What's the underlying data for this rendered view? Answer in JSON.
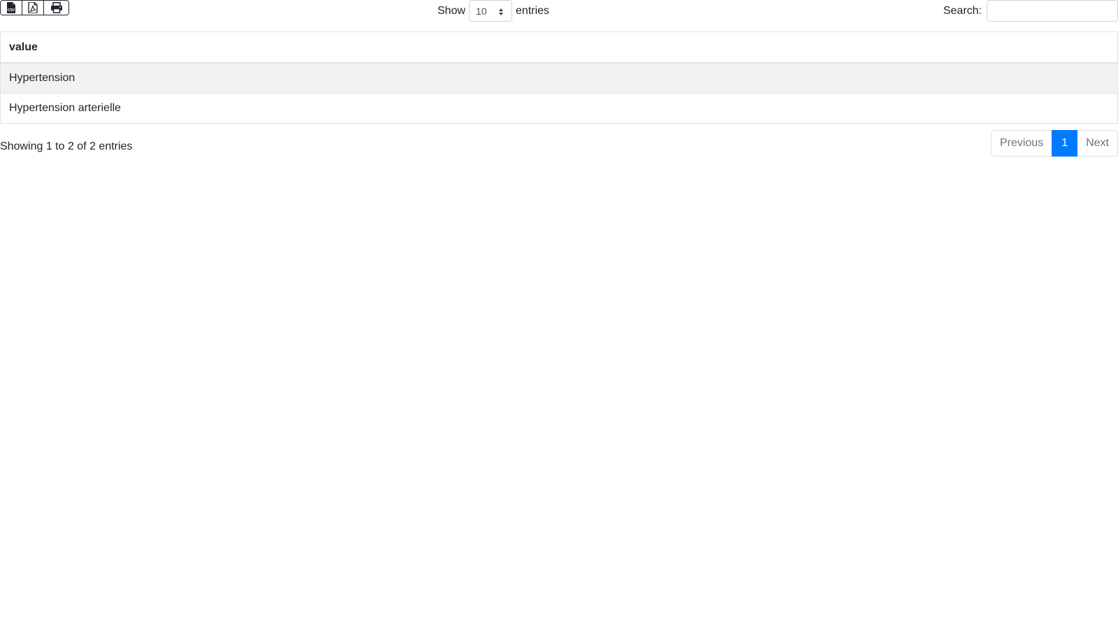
{
  "toolbar": {
    "export_buttons": [
      {
        "icon": "file-csv-icon"
      },
      {
        "icon": "file-pdf-icon"
      },
      {
        "icon": "print-icon"
      }
    ]
  },
  "length": {
    "label_before": "Show",
    "selected": "10",
    "label_after": "entries"
  },
  "search": {
    "label": "Search:",
    "value": "",
    "placeholder": ""
  },
  "table": {
    "columns": [
      "value"
    ],
    "rows": [
      [
        "Hypertension"
      ],
      [
        "Hypertension arterielle"
      ]
    ]
  },
  "footer": {
    "info": "Showing 1 to 2 of 2 entries",
    "prev_label": "Previous",
    "current_page": "1",
    "next_label": "Next"
  },
  "colors": {
    "accent": "#007bff",
    "row_stripe": "#f2f2f2",
    "border": "#dee2e6"
  }
}
